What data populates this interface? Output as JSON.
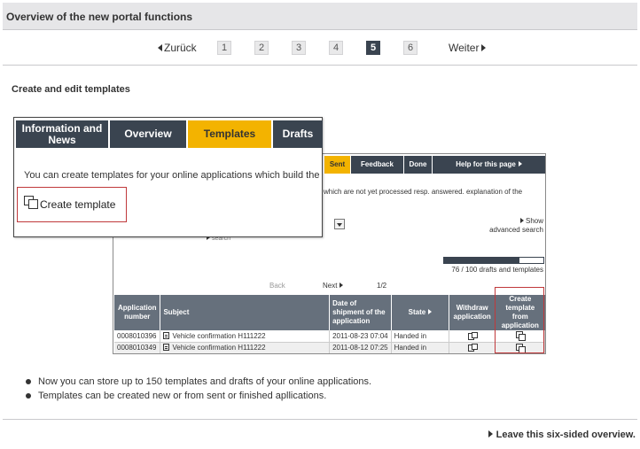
{
  "page_title": "Overview of the new portal functions",
  "pager": {
    "prev_label": "Zurück",
    "next_label": "Weiter",
    "pages": [
      "1",
      "2",
      "3",
      "4",
      "5",
      "6"
    ],
    "current": "5"
  },
  "section_heading": "Create and edit templates",
  "screenshot": {
    "tabs": [
      "Sent",
      "Feedback",
      "Done",
      "Help for this page"
    ],
    "info_text": "which are not yet processed resp. answered.  explanation of the",
    "show_label": "Show",
    "advanced_search_label": "advanced search",
    "search_label": "search",
    "progress_fraction": 0.76,
    "drafts_count": "76 / 100 drafts and templates",
    "nav_back": "Back",
    "nav_next": "Next",
    "nav_page": "1/2",
    "columns": [
      "Application number",
      "Subject",
      "Date of shipment of the application",
      "State",
      "Withdraw application",
      "Create template from application"
    ],
    "rows": [
      {
        "number": "0008010396",
        "subject": "Vehicle confirmation H111222",
        "date": "2011-08-23 07:04",
        "state": "Handed in"
      },
      {
        "number": "0008010349",
        "subject": "Vehicle confirmation H111222",
        "date": "2011-08-12 07:25",
        "state": "Handed in"
      }
    ]
  },
  "popup": {
    "tabs": [
      "Information and News",
      "Overview",
      "Templates",
      "Drafts"
    ],
    "active_tab": "Templates",
    "text": "You can create templates for your online applications which build the",
    "create_template_label": "Create template"
  },
  "bullets": [
    "Now you can store up to 150 templates and drafts of your online applications.",
    "Templates can be created new or from sent or finished apllications."
  ],
  "leave_link": "Leave this six-sided overview.",
  "colors": {
    "accent": "#f3b300",
    "dark_tab": "#3a4450",
    "highlight": "#c0393b",
    "header_bg": "#e6e6e8"
  }
}
